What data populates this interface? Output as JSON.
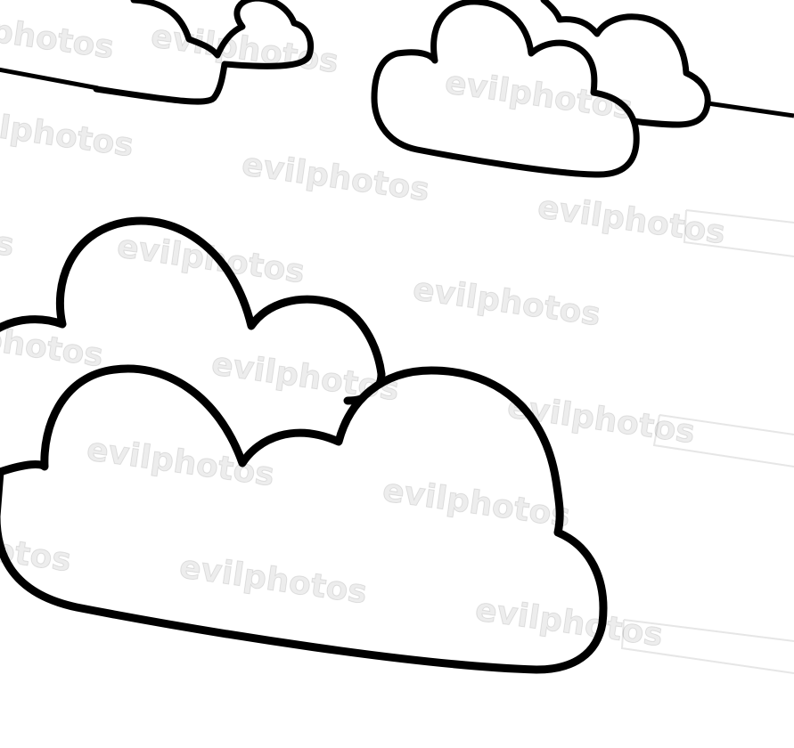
{
  "watermark": {
    "text": "evilphotos"
  },
  "colors": {
    "background": "#ffffff",
    "outline": "#000000",
    "watermark": "#000000"
  }
}
